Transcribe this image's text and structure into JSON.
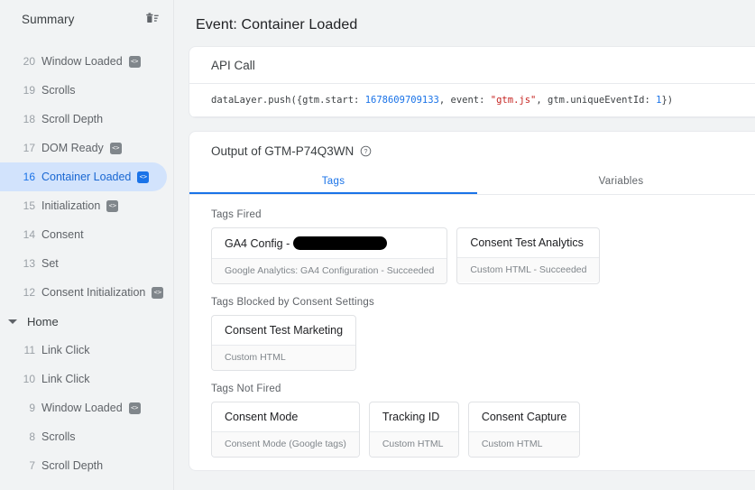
{
  "sidebar": {
    "title": "Summary",
    "clear_icon": "trash-icon",
    "items": [
      {
        "num": "20",
        "label": "Window Loaded",
        "badge": "<>",
        "selected": false
      },
      {
        "num": "19",
        "label": "Scrolls",
        "badge": "",
        "selected": false
      },
      {
        "num": "18",
        "label": "Scroll Depth",
        "badge": "",
        "selected": false
      },
      {
        "num": "17",
        "label": "DOM Ready",
        "badge": "<>",
        "selected": false
      },
      {
        "num": "16",
        "label": "Container Loaded",
        "badge": "<>",
        "selected": true
      },
      {
        "num": "15",
        "label": "Initialization",
        "badge": "<>",
        "selected": false
      },
      {
        "num": "14",
        "label": "Consent",
        "badge": "",
        "selected": false
      },
      {
        "num": "13",
        "label": "Set",
        "badge": "",
        "selected": false
      },
      {
        "num": "12",
        "label": "Consent Initialization",
        "badge": "<>",
        "selected": false
      }
    ],
    "group": {
      "label": "Home",
      "caret_icon": "chevron-down-icon"
    },
    "items_after": [
      {
        "num": "11",
        "label": "Link Click",
        "badge": "",
        "selected": false
      },
      {
        "num": "10",
        "label": "Link Click",
        "badge": "",
        "selected": false
      },
      {
        "num": "9",
        "label": "Window Loaded",
        "badge": "<>",
        "selected": false
      },
      {
        "num": "8",
        "label": "Scrolls",
        "badge": "",
        "selected": false
      },
      {
        "num": "7",
        "label": "Scroll Depth",
        "badge": "",
        "selected": false
      }
    ]
  },
  "main": {
    "page_title": "Event: Container Loaded",
    "api_card": {
      "heading": "API Call",
      "code": {
        "prefix": "dataLayer.push({gtm.start: ",
        "number1": "1678609709133",
        "mid1": ", event: ",
        "string1": "\"gtm.js\"",
        "mid2": ", gtm.uniqueEventId: ",
        "number2": "1",
        "suffix": "})"
      }
    },
    "output_card": {
      "heading": "Output of GTM-P74Q3WN",
      "help_icon": "help-circle-icon",
      "tabs": [
        {
          "label": "Tags",
          "active": true
        },
        {
          "label": "Variables",
          "active": false
        }
      ],
      "sections": [
        {
          "label": "Tags Fired",
          "tags": [
            {
              "name": "GA4 Config -",
              "redacted": true,
              "status": "Google Analytics: GA4 Configuration - Succeeded"
            },
            {
              "name": "Consent Test Analytics",
              "redacted": false,
              "status": "Custom HTML - Succeeded"
            }
          ]
        },
        {
          "label": "Tags Blocked by Consent Settings",
          "tags": [
            {
              "name": "Consent Test Marketing",
              "redacted": false,
              "status": "Custom HTML"
            }
          ]
        },
        {
          "label": "Tags Not Fired",
          "tags": [
            {
              "name": "Consent Mode",
              "redacted": false,
              "status": "Consent Mode (Google tags)"
            },
            {
              "name": "Tracking ID",
              "redacted": false,
              "status": "Custom HTML"
            },
            {
              "name": "Consent Capture",
              "redacted": false,
              "status": "Custom HTML"
            }
          ]
        }
      ]
    }
  },
  "colors": {
    "accent": "#1a73e8",
    "selected_bg": "#d2e3fc",
    "page_bg": "#f1f3f4",
    "code_number": "#1a73e8",
    "code_string": "#c5221f"
  }
}
